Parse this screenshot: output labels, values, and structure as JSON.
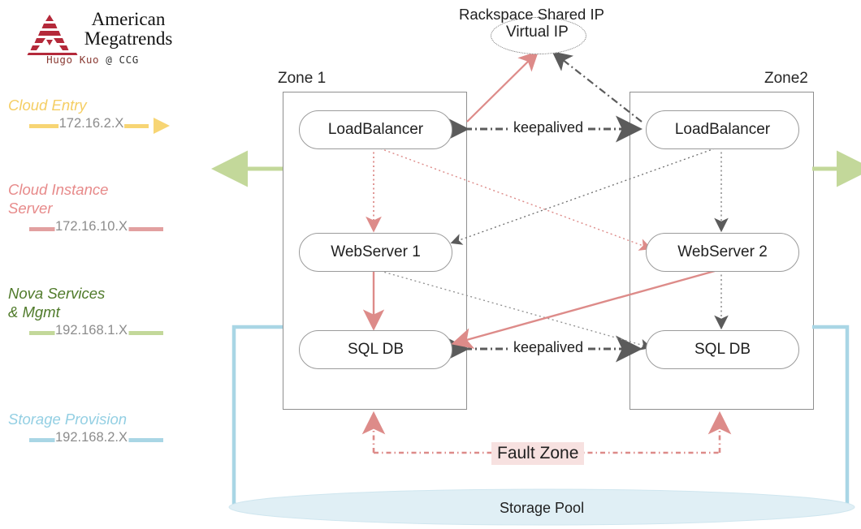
{
  "brand": {
    "line1": "American",
    "line2": "Megatrends",
    "byline_name": "Hugo Kuo",
    "byline_at": " @ ",
    "byline_org": "CCG",
    "logo_icon": "amt-triangle-logo",
    "logo_color": "#b4293a"
  },
  "legend": {
    "items": [
      {
        "title": "Cloud Entry",
        "subnet": "172.16.2.X",
        "line_color": "#f7d574",
        "text_color": "#f5ce63",
        "arrow": true
      },
      {
        "title": "Cloud Instance\nServer",
        "subnet": "172.16.10.X",
        "line_color": "#e2a0a0",
        "text_color": "#e78a8a",
        "arrow": false
      },
      {
        "title": "Nova Services\n& Mgmt",
        "subnet": "192.168.1.X",
        "line_color": "#c3d89a",
        "text_color": "#4f7a2a",
        "arrow": false
      },
      {
        "title": "Storage Provision",
        "subnet": "192.168.2.X",
        "line_color": "#a9d6e5",
        "text_color": "#93cfe3",
        "arrow": false
      }
    ]
  },
  "diagram": {
    "vip": {
      "caption": "Rackspace Shared IP",
      "label": "Virtual IP"
    },
    "zones": [
      {
        "label": "Zone 1",
        "nodes": [
          {
            "id": "lb1",
            "label": "LoadBalancer"
          },
          {
            "id": "web1",
            "label": "WebServer 1"
          },
          {
            "id": "db1",
            "label": "SQL DB"
          }
        ]
      },
      {
        "label": "Zone2",
        "nodes": [
          {
            "id": "lb2",
            "label": "LoadBalancer"
          },
          {
            "id": "web2",
            "label": "WebServer 2"
          },
          {
            "id": "db2",
            "label": "SQL DB"
          }
        ]
      }
    ],
    "edge_labels": {
      "keepalived_lb": "keepalived",
      "keepalived_db": "keepalived"
    },
    "fault_zone_label": "Fault Zone",
    "storage_pool_label": "Storage Pool"
  },
  "colors": {
    "salmon": "#dd8b89",
    "gray_dark": "#5b5b5b",
    "gray_line": "#8f8f8f",
    "green": "#c3d89a",
    "blue": "#a9d6e5",
    "blue_fill": "#e0eff5",
    "yellow": "#f7d574",
    "fault_bg": "#f7e1e0"
  }
}
